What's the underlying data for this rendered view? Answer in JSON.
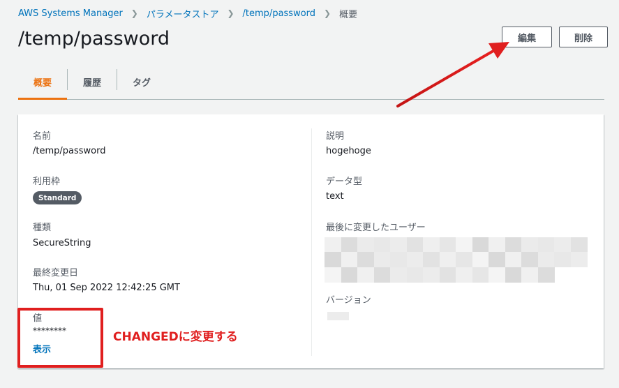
{
  "breadcrumb": {
    "items": [
      "AWS Systems Manager",
      "パラメータストア",
      "/temp/password"
    ],
    "current": "概要"
  },
  "header": {
    "title": "/temp/password",
    "edit_label": "編集",
    "delete_label": "削除"
  },
  "tabs": {
    "overview": "概要",
    "history": "履歴",
    "tags": "タグ"
  },
  "details": {
    "name_label": "名前",
    "name_value": "/temp/password",
    "tier_label": "利用枠",
    "tier_value": "Standard",
    "type_label": "種類",
    "type_value": "SecureString",
    "modified_label": "最終変更日",
    "modified_value": "Thu, 01 Sep 2022 12:42:25 GMT",
    "value_label": "値",
    "value_masked": "********",
    "show_label": "表示",
    "description_label": "説明",
    "description_value": "hogehoge",
    "datatype_label": "データ型",
    "datatype_value": "text",
    "last_user_label": "最後に変更したユーザー",
    "version_label": "バージョン"
  },
  "annotation": {
    "text": "CHANGEDに変更する"
  },
  "colors": {
    "link": "#0073bb",
    "accent_tab": "#ec7211",
    "annotation_red": "#e01f1f",
    "badge": "#545b64"
  }
}
